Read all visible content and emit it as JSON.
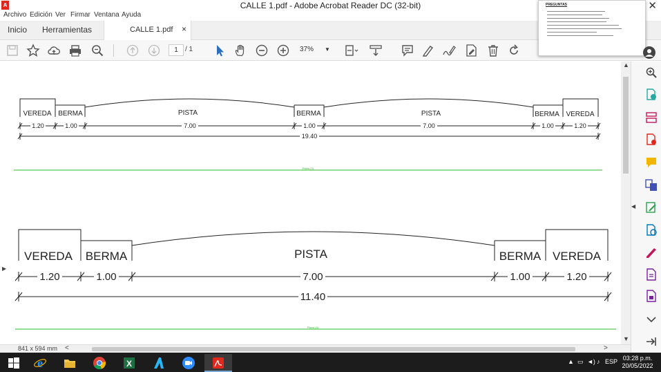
{
  "window": {
    "title": "CALLE 1.pdf - Adobe Acrobat Reader DC (32-bit)",
    "app_icon_letter": "A",
    "close_glyph": "✕"
  },
  "menu": [
    "Archivo",
    "Edición",
    "Ver",
    "Firmar",
    "Ventana",
    "Ayuda"
  ],
  "tabs": {
    "home": "Inicio",
    "tools": "Herramientas",
    "document": "CALLE 1.pdf",
    "close_glyph": "×"
  },
  "toolbar": {
    "page_current": "1",
    "page_total": "/ 1",
    "zoom": "37%",
    "icons": [
      "save-icon",
      "star-icon",
      "cloud-upload-icon",
      "print-icon",
      "search-icon",
      "page-up-icon",
      "page-down-icon",
      "select-cursor-icon",
      "hand-icon",
      "zoom-out-icon",
      "zoom-in-icon",
      "page-fit-icon",
      "scroll-mode-icon",
      "comment-icon",
      "highlight-icon",
      "sign-icon",
      "edit-pdf-icon",
      "delete-icon",
      "rotate-icon"
    ]
  },
  "thumbnail_popup": {
    "title": "PREGUNTAS"
  },
  "drawing": {
    "top_section": {
      "labels": [
        "VEREDA",
        "BERMA",
        "PISTA",
        "BERMA",
        "PISTA",
        "BERMA",
        "VEREDA"
      ],
      "dims": [
        "1.20",
        "1.00",
        "7.00",
        "1.00",
        "7.00",
        "1.00",
        "1.20"
      ],
      "total": "19.40",
      "plan_label": "Plano (3)"
    },
    "bottom_section": {
      "labels": [
        "VEREDA",
        "BERMA",
        "PISTA",
        "BERMA",
        "VEREDA"
      ],
      "dims": [
        "1.20",
        "1.00",
        "7.00",
        "1.00",
        "1.20"
      ],
      "total": "11.40",
      "plan_label": "Plano (4)"
    }
  },
  "status": {
    "page_size": "841 x 594 mm",
    "left_arrow": "<",
    "right_arrow": ">"
  },
  "taskbar": {
    "apps": [
      "windows-start-icon",
      "internet-explorer-icon",
      "file-explorer-icon",
      "chrome-icon",
      "excel-icon",
      "autocad-icon",
      "zoom-icon",
      "acrobat-icon"
    ],
    "language": "ESP",
    "time": "03:28 p.m.",
    "date": "20/05/2022"
  },
  "colors": {
    "accent_red": "#e0281c",
    "icon_blue": "#2a6ebf",
    "plan_green": "#2db82d",
    "taskbar": "#1c1c1c"
  }
}
